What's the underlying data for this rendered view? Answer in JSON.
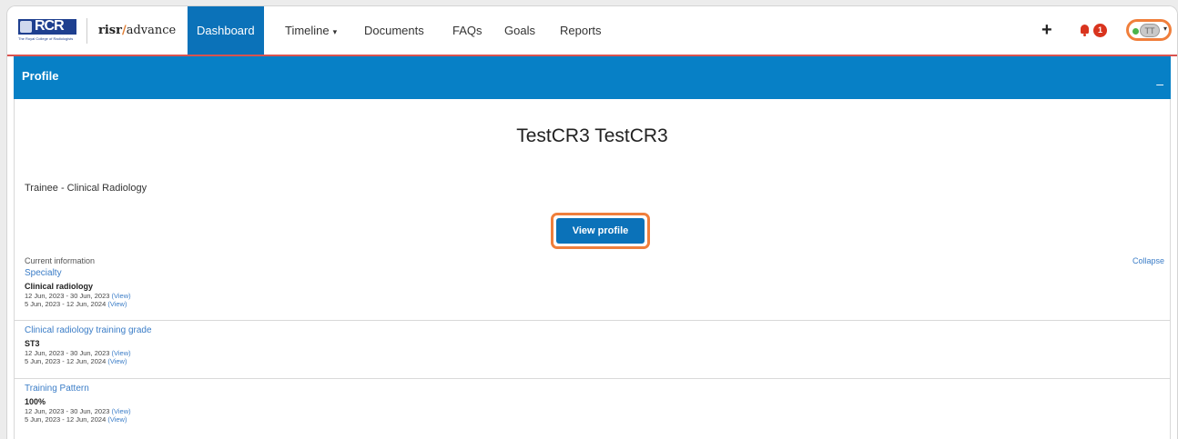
{
  "logo": {
    "text": "RCR",
    "subtitle": "The Royal College of Radiologists"
  },
  "brand": {
    "part1": "risr",
    "slash": "/",
    "part2": "advance"
  },
  "nav": {
    "items": [
      {
        "label": "Dashboard",
        "active": true
      },
      {
        "label": "Timeline",
        "caret": true
      },
      {
        "label": "Documents"
      },
      {
        "label": "FAQs"
      },
      {
        "label": "Goals"
      },
      {
        "label": "Reports"
      }
    ],
    "plus_icon": "+",
    "notification_count": "1",
    "user_initials": "TT"
  },
  "panel": {
    "title": "Profile",
    "minimize": "–",
    "user_name": "TestCR3 TestCR3",
    "role": "Trainee - Clinical Radiology",
    "view_profile_label": "View profile",
    "current_info_label": "Current information",
    "collapse_label": "Collapse",
    "sections": [
      {
        "title": "Specialty",
        "value": "Clinical radiology",
        "dates": [
          {
            "range": "12 Jun, 2023 - 30 Jun, 2023",
            "link": "(View)"
          },
          {
            "range": "5 Jun, 2023 - 12 Jun, 2024",
            "link": "(View)"
          }
        ]
      },
      {
        "title": "Clinical radiology training grade",
        "value": "ST3",
        "dates": [
          {
            "range": "12 Jun, 2023 - 30 Jun, 2023",
            "link": "(View)"
          },
          {
            "range": "5 Jun, 2023 - 12 Jun, 2024",
            "link": "(View)"
          }
        ]
      },
      {
        "title": "Training Pattern",
        "value": "100%",
        "dates": [
          {
            "range": "12 Jun, 2023 - 30 Jun, 2023",
            "link": "(View)"
          },
          {
            "range": "5 Jun, 2023 - 12 Jun, 2024",
            "link": "(View)"
          }
        ]
      }
    ]
  },
  "colors": {
    "primary": "#0b72b9",
    "header": "#0780c6",
    "link": "#3b7dc7",
    "highlight": "#f07f3c",
    "alert": "#d9341e"
  }
}
